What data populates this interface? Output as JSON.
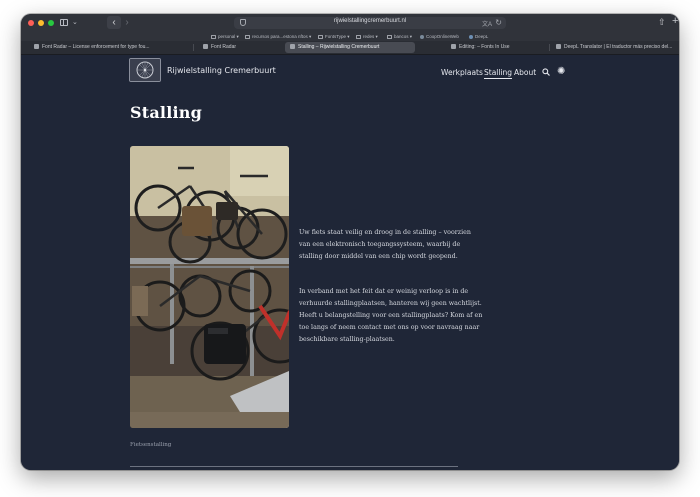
{
  "browser": {
    "url": "rijwielstallingcremerbuurt.nl",
    "bookmarks": [
      {
        "label": "personal ▾",
        "type": "folder"
      },
      {
        "label": "recursos para...estona nftos ▾",
        "type": "folder"
      },
      {
        "label": "FontsType ▾",
        "type": "folder"
      },
      {
        "label": "redes ▾",
        "type": "folder"
      },
      {
        "label": "bancos ▾",
        "type": "folder"
      },
      {
        "label": "CoopOnlineWeb",
        "type": "link"
      },
      {
        "label": "DeepL",
        "type": "link"
      }
    ],
    "tabs": [
      {
        "label": "Font Radar – License enforcement for type fou..."
      },
      {
        "label": "Font Radar"
      },
      {
        "label": "Stalling – Rijwielstalling Cremerbuurt",
        "active": true
      },
      {
        "label": "Editing: – Fonts In Use"
      },
      {
        "label": "DeepL Translator | El traductor más preciso del..."
      }
    ]
  },
  "site": {
    "title": "Rijwielstalling Cremerbuurt",
    "nav": [
      "Werkplaats",
      "Stalling",
      "About"
    ],
    "current_nav": "Stalling"
  },
  "main": {
    "heading": "Stalling",
    "paragraph1": "Uw fiets staat veilig en droog in de stalling – voorzien van een elektronisch toegangssysteem, waarbij de stalling door middel van een chip wordt geopend.",
    "paragraph2": "In verband met het feit dat er weinig verloop is in de verhuurde stallingplaatsen, hanteren wij geen wachtlijst. Heeft u belangstelling voor een stallingplaats? Kom af en toe langs of neem contact met ons op voor navraag naar beschikbare stalling-plaatsen.",
    "caption": "Fietsenstalling"
  },
  "colors": {
    "page_background": "#1f2637",
    "text": "#e6e8ee",
    "browser_chrome": "#30333a"
  }
}
